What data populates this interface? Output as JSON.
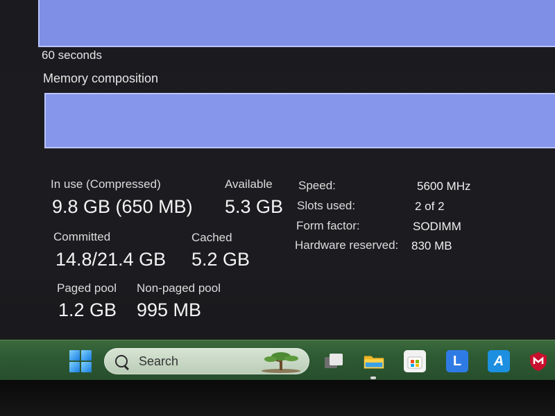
{
  "graph_label": "60 seconds",
  "composition_label": "Memory composition",
  "stats": {
    "in_use_label": "In use (Compressed)",
    "in_use_value": "9.8 GB (650 MB)",
    "available_label": "Available",
    "available_value": "5.3 GB",
    "committed_label": "Committed",
    "committed_value": "14.8/21.4 GB",
    "cached_label": "Cached",
    "cached_value": "5.2 GB",
    "paged_pool_label": "Paged pool",
    "paged_pool_value": "1.2 GB",
    "non_paged_pool_label": "Non-paged pool",
    "non_paged_pool_value": "995 MB"
  },
  "info": {
    "speed_label": "Speed:",
    "speed_value": "5600 MHz",
    "slots_label": "Slots used:",
    "slots_value": "2 of 2",
    "form_factor_label": "Form factor:",
    "form_factor_value": "SODIMM",
    "hw_reserved_label": "Hardware reserved:",
    "hw_reserved_value": "830 MB"
  },
  "taskbar": {
    "search_placeholder": "Search",
    "icons": [
      "windows-start-icon",
      "task-view-icon",
      "file-explorer-icon",
      "microsoft-store-icon",
      "l-app-icon",
      "a-app-icon",
      "mcafee-icon"
    ],
    "l_app_letter": "L",
    "a_app_letter": "A"
  },
  "colors": {
    "graph_fill": "#7f8fe6",
    "graph_border": "#b8c3ff",
    "taskbar": "#2e5a33"
  }
}
